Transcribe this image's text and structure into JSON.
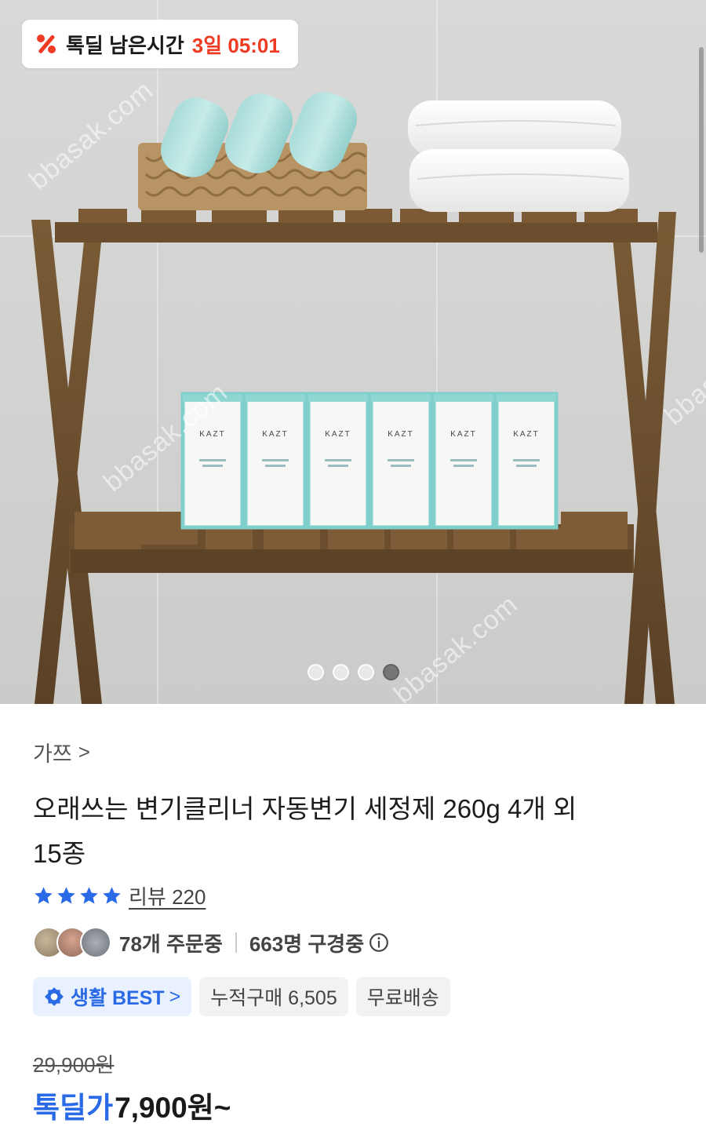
{
  "timer": {
    "label": "톡딜 남은시간",
    "value": "3일 05:01",
    "icon": "percent-tag-icon",
    "accent_color": "#ef3b24"
  },
  "gallery": {
    "watermark_text": "bbasak.com",
    "dot_count": 4,
    "active_index": 3
  },
  "product": {
    "brand": "가쯔",
    "brand_chevron": ">",
    "title": "오래쓰는 변기클리너 자동변기 세정제 260g 4개 외 15종",
    "title_line1": "오래쓰는 변기클리너 자동변기 세정제 260g 4개 외",
    "title_line2": "15종",
    "rating_stars": 4,
    "review_label": "리뷰 220",
    "orders": "78개 주문중",
    "viewers": "663명 구경중"
  },
  "chips": {
    "best": "생활 BEST",
    "best_chevron": ">",
    "cumulative": "누적구매 6,505",
    "shipping": "무료배송"
  },
  "price": {
    "original": "29,900원",
    "deal_label": "톡딜가",
    "deal_price": "7,900원~",
    "accent_color": "#2b6ae6"
  },
  "box_brand": "KAZT"
}
